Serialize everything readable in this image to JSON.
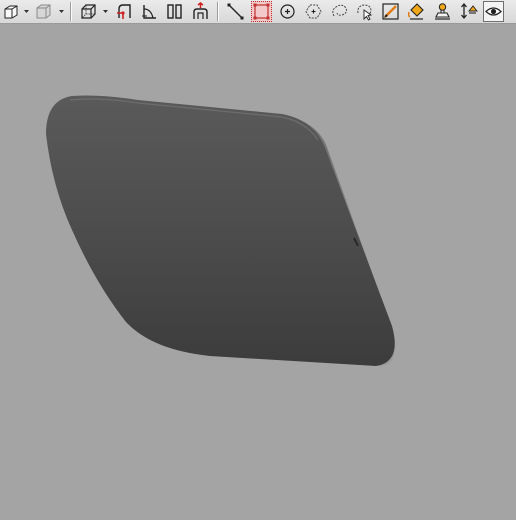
{
  "toolbar": {
    "groups": [
      [
        "view-cube",
        "view-shaded"
      ],
      [
        "bounding-box",
        "snap-corner",
        "corner-measure",
        "split-view",
        "pedestrian"
      ],
      [
        "line-tool",
        "select-rect",
        "pick-point",
        "pick-hexagon",
        "pick-lasso",
        "pick-cursor",
        "edit-pencil",
        "fill-bucket",
        "stamp-tool",
        "move-updown",
        "visibility-eye"
      ]
    ],
    "active_tool": "select-rect"
  },
  "colors": {
    "toolbar_bg": "#e2e2e2",
    "viewport_bg": "#a4a4a4",
    "model_fill": "#4a4a4a",
    "active_tool": "#c03030"
  },
  "viewport": {
    "object": "shaded-3d-cap-surface"
  }
}
